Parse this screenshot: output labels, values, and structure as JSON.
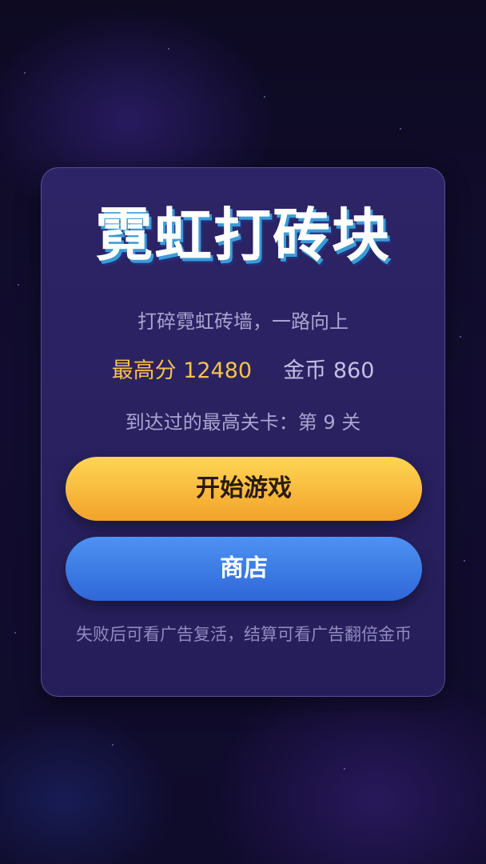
{
  "game": {
    "title": "霓虹打砖块",
    "subtitle": "打碎霓虹砖墙，一路向上",
    "high_score_label": "最高分",
    "high_score": "12480",
    "coins_label": "金币",
    "coins": "860",
    "max_level_text": "到达过的最高关卡：第 9 关",
    "start_button_label": "开始游戏",
    "shop_button_label": "商店",
    "hint_text": "失败后可看广告复活，结算可看广告翻倍金币"
  },
  "colors": {
    "background": "#120d30",
    "card": "#2a2262",
    "title_shadow": "#3b9bd8",
    "gold": "#f5c34a",
    "start_button": "#f8bf3f",
    "shop_button": "#3f7de6"
  }
}
